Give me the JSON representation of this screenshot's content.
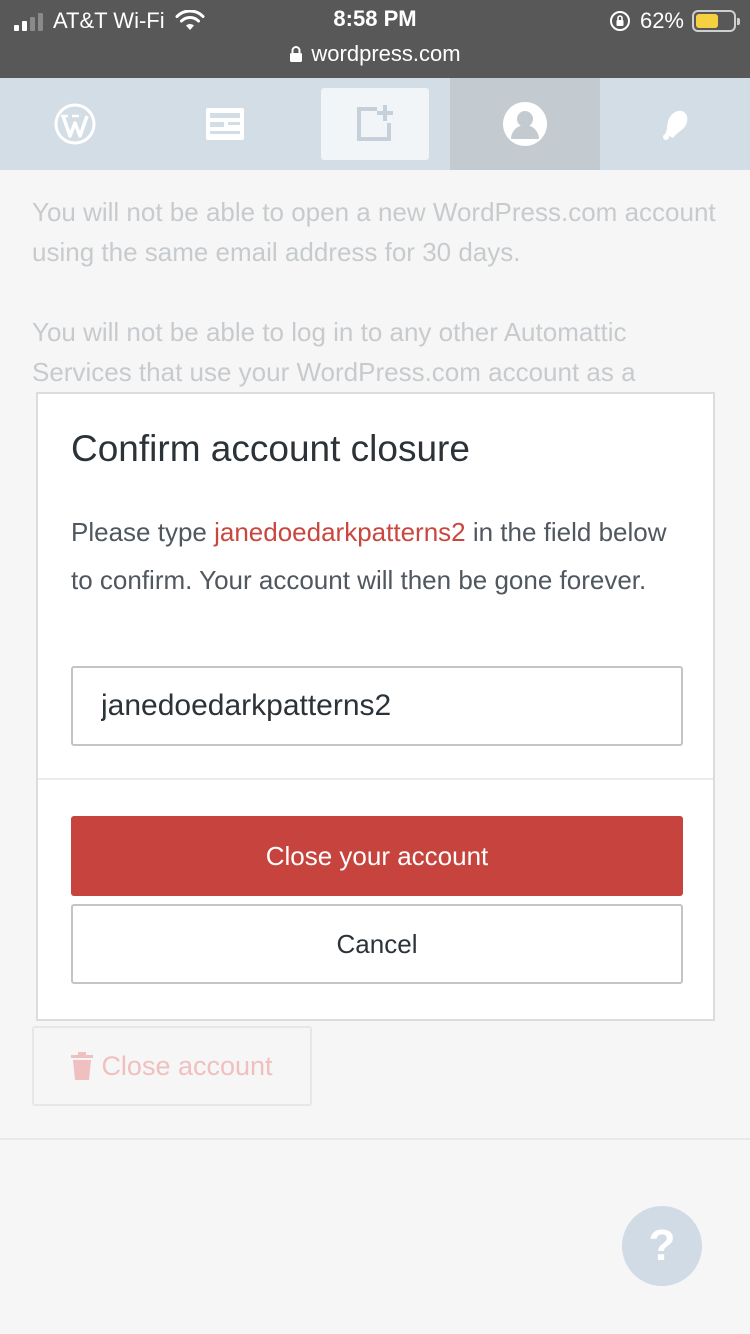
{
  "status_bar": {
    "carrier": "AT&T Wi-Fi",
    "time": "8:58 PM",
    "battery": "62%",
    "battery_level": 0.62,
    "url": "wordpress.com"
  },
  "top_nav": {
    "items": [
      {
        "icon": "wordpress-logo-icon"
      },
      {
        "icon": "reader-icon"
      },
      {
        "icon": "write-post-icon"
      },
      {
        "icon": "avatar-icon"
      },
      {
        "icon": "notifications-bell-icon"
      }
    ]
  },
  "background": {
    "paragraph1": "You will not be able to open a new WordPress.com account using the same email address for 30 days.",
    "paragraph2": "You will not be able to log in to any other Automattic Services that use your WordPress.com account as a",
    "close_account_label": "Close account"
  },
  "modal": {
    "title": "Confirm account closure",
    "text_before": "Please type ",
    "username": "janedoedarkpatterns2",
    "text_after": " in the field below to confirm. Your account will then be gone forever.",
    "input_value": "janedoedarkpatterns2",
    "close_button": "Close your account",
    "cancel_button": "Cancel"
  },
  "help": {
    "label": "?"
  },
  "colors": {
    "accent_red": "#c6443d",
    "nav_bg": "#d2dde6",
    "status_bar_bg": "#585858"
  }
}
